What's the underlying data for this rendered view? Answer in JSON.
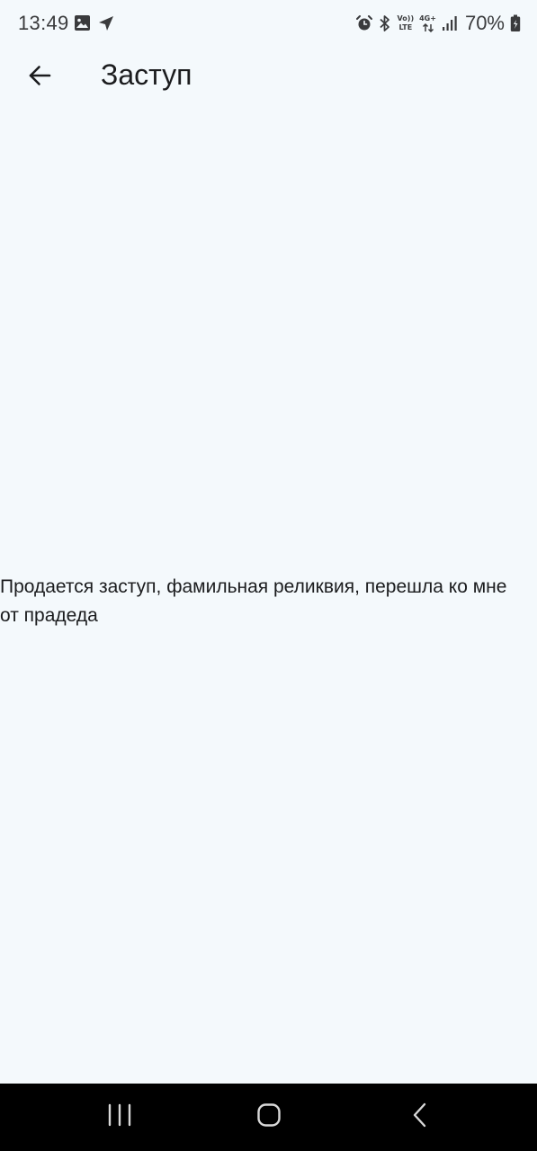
{
  "status_bar": {
    "time": "13:49",
    "left_icons": [
      "image-icon",
      "location-arrow-icon"
    ],
    "right_icons": [
      "alarm-icon",
      "bluetooth-icon",
      "volte-icon",
      "network-4g-icon",
      "signal-icon"
    ],
    "volte_label_top": "Vo))",
    "volte_label_bottom": "LTE",
    "network_label": "4G+",
    "battery_percent": "70%"
  },
  "app_bar": {
    "back_icon": "arrow-back-icon",
    "title": "Заступ"
  },
  "content": {
    "description": "Продается заступ, фамильная реликвия, перешла ко мне от прадеда"
  },
  "nav_bar": {
    "icons": [
      "recents-icon",
      "home-icon",
      "back-icon"
    ]
  },
  "colors": {
    "background": "#f4f9fc",
    "text": "#1b1c1e",
    "nav_background": "#000000"
  }
}
